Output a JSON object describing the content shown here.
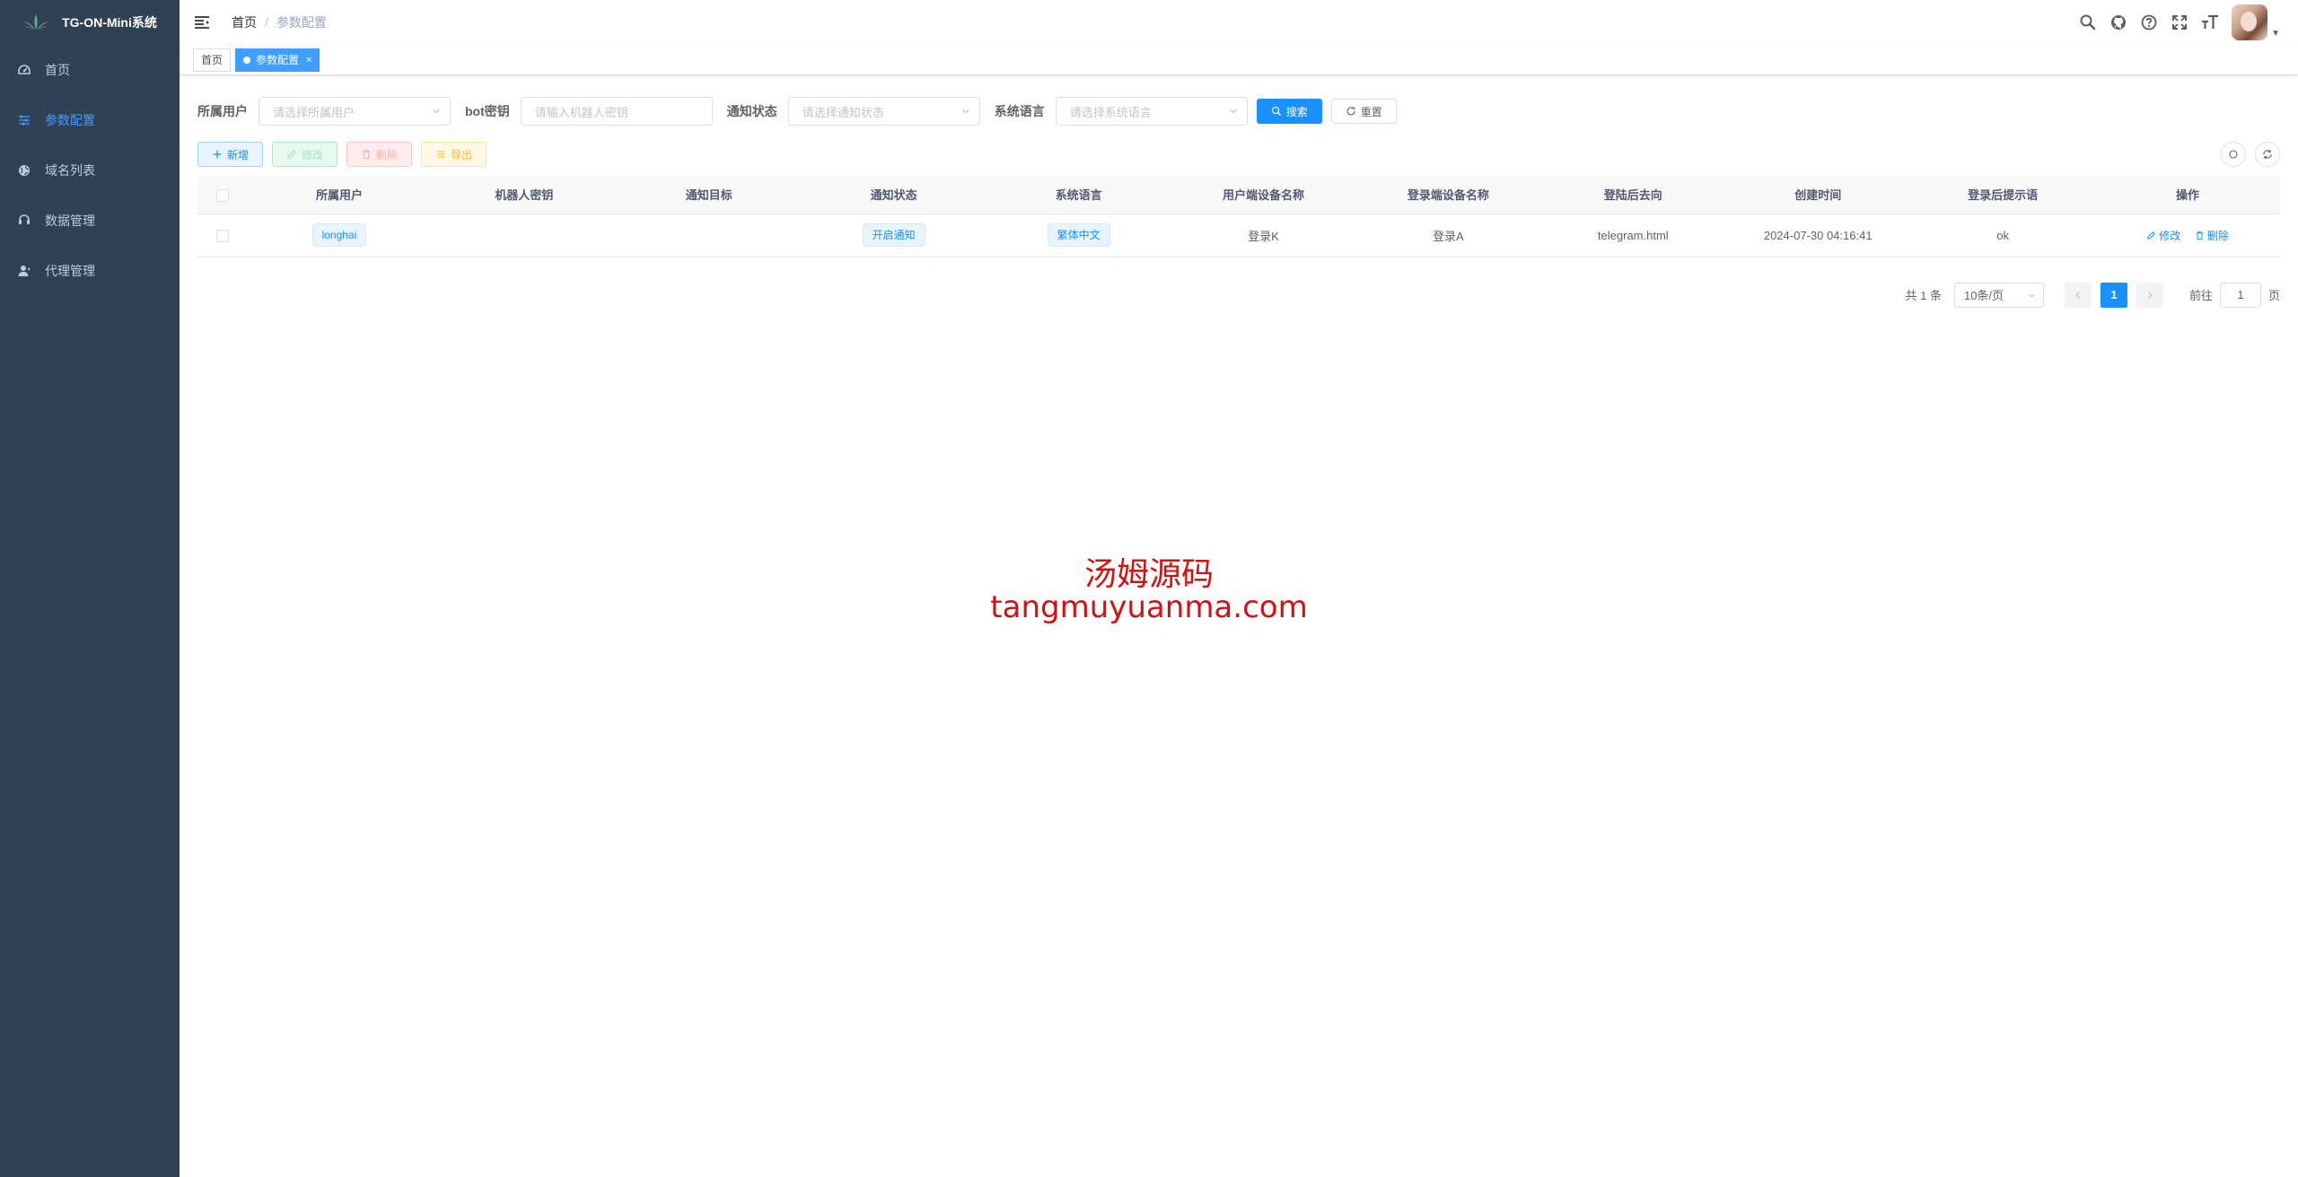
{
  "app": {
    "title": "TG-ON-Mini系统"
  },
  "sidebar": {
    "items": [
      {
        "label": "首页",
        "icon": "dashboard-icon",
        "active": false
      },
      {
        "label": "参数配置",
        "icon": "sliders-icon",
        "active": true
      },
      {
        "label": "域名列表",
        "icon": "globe-icon",
        "active": false
      },
      {
        "label": "数据管理",
        "icon": "monitor-icon",
        "active": false
      },
      {
        "label": "代理管理",
        "icon": "user-icon",
        "active": false
      }
    ]
  },
  "navbar": {
    "breadcrumb": {
      "home": "首页",
      "separator": "/",
      "current": "参数配置"
    },
    "icons": [
      "search-icon",
      "github-icon",
      "help-icon",
      "fullscreen-icon",
      "font-size-icon"
    ]
  },
  "tags": [
    {
      "label": "首页",
      "active": false
    },
    {
      "label": "参数配置",
      "active": true,
      "close": "×"
    }
  ],
  "search": {
    "user_label": "所属用户",
    "user_placeholder": "请选择所属用户",
    "bot_label": "bot密钥",
    "bot_placeholder": "请输入机器人密钥",
    "notify_label": "通知状态",
    "notify_placeholder": "请选择通知状态",
    "lang_label": "系统语言",
    "lang_placeholder": "请选择系统语言",
    "search_btn": "搜索",
    "reset_btn": "重置"
  },
  "toolbar": {
    "add": "新增",
    "edit": "修改",
    "delete": "删除",
    "export": "导出"
  },
  "table": {
    "headers": [
      "所属用户",
      "机器人密钥",
      "通知目标",
      "通知状态",
      "系统语言",
      "用户端设备名称",
      "登录端设备名称",
      "登陆后去向",
      "创建时间",
      "登录后提示语",
      "操作"
    ],
    "rows": [
      {
        "user": "longhai",
        "bot_key": "",
        "notify_target": "",
        "notify_status": "开启通知",
        "language": "繁体中文",
        "client_device": "登录K",
        "login_device": "登录A",
        "redirect": "telegram.html",
        "created": "2024-07-30 04:16:41",
        "tip": "ok",
        "edit": "修改",
        "delete": "删除"
      }
    ]
  },
  "pagination": {
    "total": "共 1 条",
    "page_size": "10条/页",
    "current": "1",
    "goto_label": "前往",
    "goto_value": "1",
    "page_suffix": "页"
  },
  "watermark": {
    "line1": "汤姆源码",
    "line2": "tangmuyuanma.com"
  },
  "colors": {
    "sidebar_bg": "#304156",
    "primary": "#1890ff",
    "active_menu": "#409eff"
  }
}
